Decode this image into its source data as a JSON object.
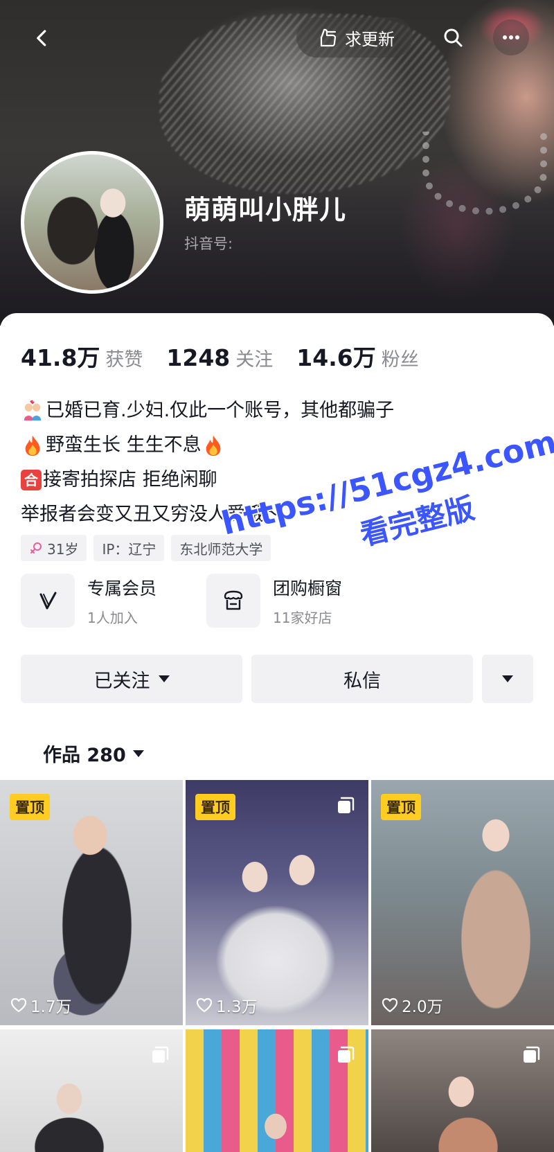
{
  "header": {
    "request_update_label": "求更新",
    "name": "萌萌叫小胖儿",
    "douyin_id_label": "抖音号:"
  },
  "stats": [
    {
      "value": "41.8万",
      "label": "获赞"
    },
    {
      "value": "1248",
      "label": "关注"
    },
    {
      "value": "14.6万",
      "label": "粉丝"
    }
  ],
  "bio": {
    "line1": "已婚已育.少妇.仅此一个账号，其他都骗子",
    "line2": "野蛮生长 生生不息",
    "line3_badge": "合",
    "line3": "接寄拍探店 拒绝闲聊",
    "line4": "举报者会变又丑又穷没人爱哦～"
  },
  "tags": {
    "age": "31岁",
    "ip": "IP：辽宁",
    "school": "东北师范大学"
  },
  "services": [
    {
      "title": "专属会员",
      "sub": "1人加入",
      "icon": "vip-v-icon"
    },
    {
      "title": "团购橱窗",
      "sub": "11家好店",
      "icon": "shop-icon"
    }
  ],
  "actions": {
    "follow_label": "已关注",
    "message_label": "私信"
  },
  "works": {
    "label": "作品 280"
  },
  "grid": [
    {
      "pinned": "置顶",
      "likes": "1.7万",
      "multi": false
    },
    {
      "pinned": "置顶",
      "likes": "1.3万",
      "multi": true
    },
    {
      "pinned": "置顶",
      "likes": "2.0万",
      "multi": false
    },
    {
      "pinned": "",
      "likes": "",
      "multi": true
    },
    {
      "pinned": "",
      "likes": "",
      "multi": true
    },
    {
      "pinned": "",
      "likes": "",
      "multi": true
    }
  ],
  "watermark": {
    "line1": "https://51cgz4.com",
    "line2": "看完整版"
  },
  "colors": {
    "pin_badge": "#ffcc22",
    "watermark": "#3b55ff",
    "he_badge": "#e8423f"
  }
}
